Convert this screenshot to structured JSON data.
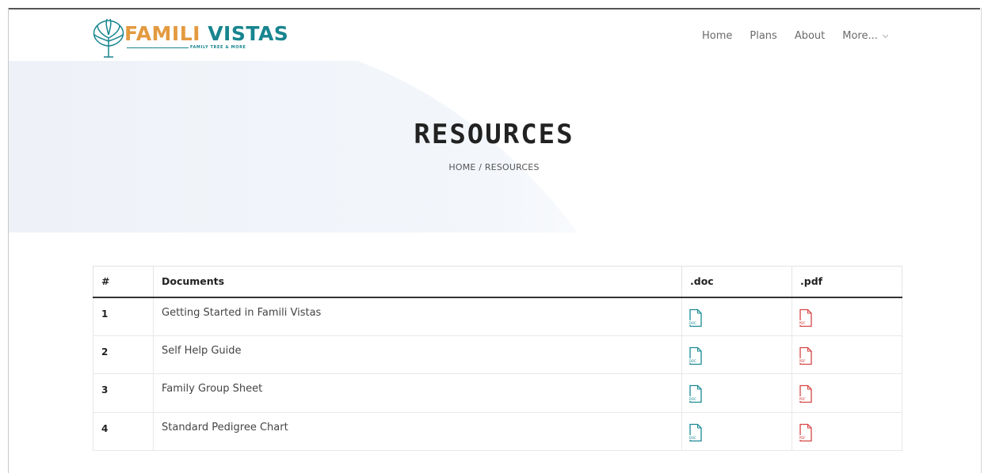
{
  "brand": {
    "name_part1": "FAMILI",
    "name_part2": "VISTAS",
    "tagline": "FAMILY TREE & MORE",
    "color_primary": "#18858f",
    "color_accent": "#e39a3f",
    "logo_icon": "tree-icon"
  },
  "nav": {
    "items": [
      {
        "label": "Home"
      },
      {
        "label": "Plans"
      },
      {
        "label": "About"
      },
      {
        "label": "More..."
      }
    ],
    "more_icon": "chevron-down-icon"
  },
  "hero": {
    "title": "RESOURCES",
    "breadcrumb": "HOME / RESOURCES"
  },
  "table": {
    "headers": {
      "num": "#",
      "documents": "Documents",
      "doc": ".doc",
      "pdf": ".pdf"
    },
    "rows": [
      {
        "num": "1",
        "document": "Getting Started in Famili Vistas",
        "doc_icon": "doc-file-icon",
        "pdf_icon": "pdf-file-icon"
      },
      {
        "num": "2",
        "document": "Self Help Guide",
        "doc_icon": "doc-file-icon",
        "pdf_icon": "pdf-file-icon"
      },
      {
        "num": "3",
        "document": "Family Group Sheet",
        "doc_icon": "doc-file-icon",
        "pdf_icon": "pdf-file-icon"
      },
      {
        "num": "4",
        "document": "Standard Pedigree Chart",
        "doc_icon": "doc-file-icon",
        "pdf_icon": "pdf-file-icon"
      }
    ],
    "doc_icon_label": "DOC",
    "pdf_icon_label": "PDF",
    "doc_icon_color": "#1a8a95",
    "pdf_icon_color": "#d64545"
  }
}
